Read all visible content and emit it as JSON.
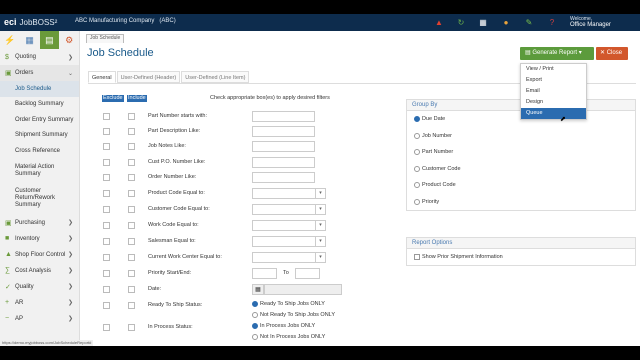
{
  "topbar": {
    "logo": "eci",
    "product": "JobBOSS²",
    "company": "ABC Manufacturing Company",
    "company_code": "(ABC)",
    "welcome_label": "Welcome,",
    "user_name": "Office Manager",
    "colors": {
      "bar": "#0d2c4d"
    }
  },
  "sidebar": {
    "icon_tabs": [
      "bolt-icon",
      "org-chart-icon",
      "chart-icon",
      "gear-icon"
    ],
    "items": [
      {
        "label": "Quoting",
        "icon": "dollar-icon"
      },
      {
        "label": "Orders",
        "icon": "cart-icon",
        "open": true
      }
    ],
    "order_subitems": [
      "Job Schedule",
      "Backlog Summary",
      "Order Entry Summary",
      "Shipment Summary",
      "Cross Reference",
      "Material Action Summary",
      "Customer Return/Rework Summary"
    ],
    "items_after": [
      {
        "label": "Purchasing",
        "icon": "cart-icon"
      },
      {
        "label": "Inventory",
        "icon": "box-icon"
      },
      {
        "label": "Shop Floor Control",
        "icon": "factory-icon"
      },
      {
        "label": "Cost Analysis",
        "icon": "calc-icon"
      },
      {
        "label": "Quality",
        "icon": "check-icon"
      },
      {
        "label": "AR",
        "icon": "plus-icon"
      },
      {
        "label": "AP",
        "icon": "minus-icon"
      }
    ]
  },
  "main": {
    "page_tab": "Job Schedule",
    "title": "Job Schedule",
    "generate_button": "Generate Report",
    "close_button": "Close",
    "generate_menu": [
      "View / Print",
      "Export",
      "Email",
      "Design",
      "Queue"
    ],
    "form_tabs": [
      "General",
      "User-Defined (Header)",
      "User-Defined (Line Item)"
    ],
    "exclude_label": "Exclude",
    "include_label": "Include",
    "check_note": "Check appropriate box(es) to apply desired filters",
    "filters": {
      "part_number": "Part Number starts with:",
      "part_description": "Part Description Like:",
      "job_notes": "Job Notes Like:",
      "cust_po": "Cust P.O. Number Like:",
      "order_number": "Order Number Like:",
      "product_code": "Product Code Equal to:",
      "customer_code": "Customer Code Equal to:",
      "work_code": "Work Code Equal to:",
      "salesman": "Salesman Equal to:",
      "work_center": "Current Work Center Equal to:",
      "priority": "Priority Start/End:",
      "priority_to": "To",
      "date": "Date:",
      "ready_to_ship": "Ready To Ship Status:",
      "in_process": "In Process Status:"
    },
    "ready_options": [
      "Ready To Ship Jobs ONLY",
      "Not Ready To Ship Jobs ONLY"
    ],
    "process_options": [
      "In Process Jobs ONLY",
      "Not In Process Jobs ONLY"
    ],
    "group_by": {
      "title": "Group By",
      "options": [
        "Due Date",
        "Job Number",
        "Part Number",
        "Customer Code",
        "Product Code",
        "Priority"
      ]
    },
    "report_options": {
      "title": "Report Options",
      "option": "Show Prior Shipment Information"
    },
    "status_url": "https://demo.myjobboss.com/JobScheduleReport#"
  }
}
